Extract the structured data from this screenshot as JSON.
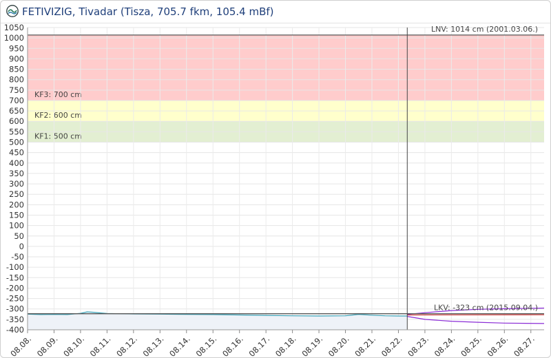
{
  "header": {
    "title": "FETIVIZIG, Tivadar (Tisza, 705.7 fkm, 105.4 mBf)",
    "logo_icon": "water-wave-logo-icon"
  },
  "chart_data": {
    "type": "line",
    "title": "FETIVIZIG, Tivadar (Tisza, 705.7 fkm, 105.4 mBf)",
    "ylim": [
      -400,
      1050
    ],
    "y_ticks": [
      1050,
      1000,
      950,
      900,
      850,
      800,
      750,
      700,
      650,
      600,
      550,
      500,
      450,
      400,
      350,
      300,
      250,
      200,
      150,
      100,
      50,
      0,
      -50,
      -100,
      -150,
      -200,
      -250,
      -300,
      -350,
      -400
    ],
    "x_range": [
      "2025-08-08",
      "2025-08-27T12:00"
    ],
    "x_tick_labels": [
      "08.08.",
      "08.09.",
      "08.10.",
      "08.11.",
      "08.12.",
      "08.13.",
      "08.14.",
      "08.15.",
      "08.16.",
      "08.17.",
      "08.18.",
      "08.19.",
      "08.20.",
      "08.21.",
      "08.22.",
      "08.23.",
      "08.24.",
      "08.25.",
      "08.26.",
      "08.27."
    ],
    "grid": true,
    "zones": [
      {
        "label": "KF3: 700 cm",
        "from": 700,
        "to": 1014,
        "color": "#ffcccc"
      },
      {
        "label": "KF2: 600 cm",
        "from": 600,
        "to": 700,
        "color": "#ffffcc"
      },
      {
        "label": "KF1: 500 cm",
        "from": 500,
        "to": 600,
        "color": "#e3efd2"
      }
    ],
    "reference_lines": [
      {
        "label": "LNV: 1014 cm (2001.03.06.)",
        "value": 1014,
        "color": "#555555"
      },
      {
        "label": "LKV: -323 cm (2015.09.04.)",
        "value": -323,
        "color": "#555555"
      }
    ],
    "now_marker": "2025-08-22T08:00",
    "series": [
      {
        "color": "#3aa3b8",
        "fill": "#eef2f8",
        "points": [
          [
            "2025-08-08T00:00",
            -325
          ],
          [
            "2025-08-08T12:00",
            -327
          ],
          [
            "2025-08-09T00:00",
            -326
          ],
          [
            "2025-08-09T12:00",
            -327
          ],
          [
            "2025-08-10T00:00",
            -321
          ],
          [
            "2025-08-10T06:00",
            -314
          ],
          [
            "2025-08-10T12:00",
            -316
          ],
          [
            "2025-08-11T00:00",
            -322
          ],
          [
            "2025-08-11T12:00",
            -323
          ],
          [
            "2025-08-12T00:00",
            -324
          ],
          [
            "2025-08-13T00:00",
            -325
          ],
          [
            "2025-08-14T00:00",
            -326
          ],
          [
            "2025-08-15T00:00",
            -327
          ],
          [
            "2025-08-16T00:00",
            -329
          ],
          [
            "2025-08-17T00:00",
            -331
          ],
          [
            "2025-08-18T00:00",
            -333
          ],
          [
            "2025-08-19T00:00",
            -334
          ],
          [
            "2025-08-20T00:00",
            -333
          ],
          [
            "2025-08-20T12:00",
            -326
          ],
          [
            "2025-08-21T00:00",
            -330
          ],
          [
            "2025-08-21T12:00",
            -333
          ],
          [
            "2025-08-22T00:00",
            -334
          ],
          [
            "2025-08-22T08:00",
            -334
          ]
        ]
      },
      {
        "color": "#d23a3a",
        "points": [
          [
            "2025-08-22T08:00",
            -329
          ],
          [
            "2025-08-27T12:00",
            -328
          ]
        ]
      },
      {
        "color": "#8a2bd6",
        "points": [
          [
            "2025-08-22T08:00",
            -326
          ],
          [
            "2025-08-23T00:00",
            -318
          ],
          [
            "2025-08-24T00:00",
            -308
          ],
          [
            "2025-08-25T00:00",
            -302
          ],
          [
            "2025-08-26T00:00",
            -299
          ],
          [
            "2025-08-27T12:00",
            -296
          ]
        ]
      },
      {
        "color": "#8a2bd6",
        "points": [
          [
            "2025-08-22T08:00",
            -336
          ],
          [
            "2025-08-23T00:00",
            -350
          ],
          [
            "2025-08-24T00:00",
            -359
          ],
          [
            "2025-08-25T00:00",
            -364
          ],
          [
            "2025-08-26T00:00",
            -368
          ],
          [
            "2025-08-27T12:00",
            -370
          ]
        ]
      }
    ]
  }
}
